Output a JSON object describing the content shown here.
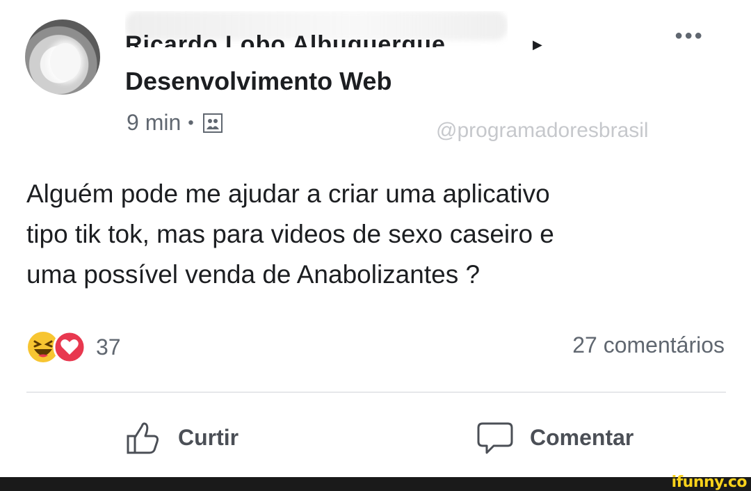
{
  "post": {
    "author_name_obscured": "Ricardo Lobo Albuquerque",
    "group_name": "Desenvolvimento Web",
    "timestamp": "9 min",
    "separator": "•",
    "watermark": "@programadoresbrasil",
    "text_lines": [
      "Alguém pode me ajudar a criar uma aplicativo",
      "tipo tik tok, mas para videos de sexo caseiro e",
      "uma possível venda de Anabolizantes ?"
    ],
    "reaction_count": "37",
    "comment_count": "27 comentários"
  },
  "actions": {
    "like_label": "Curtir",
    "comment_label": "Comentar"
  },
  "icons": {
    "more": "more-options-icon",
    "arrow": "caret-right-icon",
    "privacy": "group-privacy-icon",
    "reaction_haha": "haha-emoji-icon",
    "reaction_love": "love-reaction-icon",
    "like": "thumbs-up-icon",
    "comment": "speech-bubble-icon"
  },
  "branding": {
    "site_logo": "ifunny.co"
  },
  "colors": {
    "text_primary": "#1c1e21",
    "text_secondary": "#606770",
    "watermark": "#c6c8cc",
    "love_red": "#e8384f",
    "haha_yellow": "#f7c531",
    "ifunny_yellow": "#f9d21b"
  }
}
